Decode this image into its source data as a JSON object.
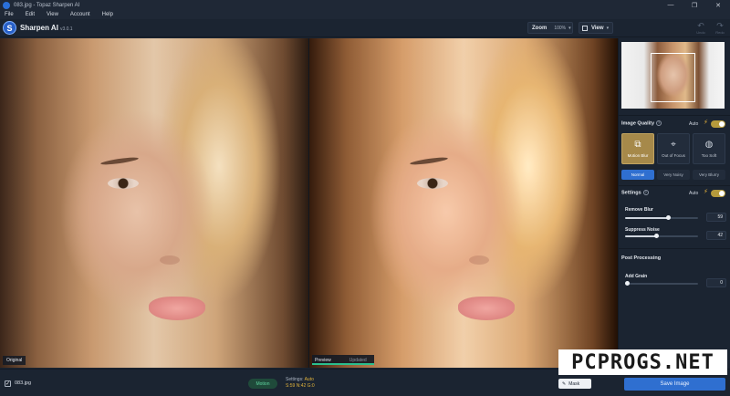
{
  "window": {
    "title": "083.jpg - Topaz Sharpen AI",
    "controls": [
      "—",
      "❐",
      "✕"
    ]
  },
  "menu": [
    "File",
    "Edit",
    "View",
    "Account",
    "Help"
  ],
  "header": {
    "app_name": "Sharpen AI",
    "version": "v3.0.1",
    "logo_letter": "S",
    "zoom_label": "Zoom",
    "zoom_value": "100%",
    "view_label": "View",
    "undo_label": "Undo",
    "redo_label": "Redo"
  },
  "viewer": {
    "left_label": "Original",
    "preview_label": "Preview",
    "updated_label": "Updated"
  },
  "panel": {
    "image_quality": {
      "title": "Image Quality",
      "auto_label": "Auto",
      "modes": [
        {
          "label": "Motion Blur",
          "active": true
        },
        {
          "label": "Out of Focus",
          "active": false
        },
        {
          "label": "Too Soft",
          "active": false
        }
      ],
      "levels": [
        {
          "label": "Normal",
          "active": true
        },
        {
          "label": "Very Noisy",
          "active": false
        },
        {
          "label": "Very Blurry",
          "active": false
        }
      ]
    },
    "settings": {
      "title": "Settings",
      "auto_label": "Auto",
      "remove_blur": {
        "label": "Remove Blur",
        "value": "59",
        "level": 59
      },
      "suppress_noise": {
        "label": "Suppress Noise",
        "value": "42",
        "level": 42
      }
    },
    "post_processing": {
      "title": "Post Processing",
      "add_grain": {
        "label": "Add Grain",
        "value": "0",
        "level": 0
      }
    }
  },
  "bottom": {
    "filename": "083.jpg",
    "check_mark": "✓",
    "mode_pill": "Motion",
    "settings_label": "Settings:",
    "settings_value": "Auto",
    "s_label": "S:",
    "s_value": "59",
    "n_label": "N:",
    "n_value": "42",
    "g_label": "G:",
    "g_value": "0",
    "mask_label": "Mask",
    "save_label": "Save Image"
  },
  "watermark": "PCPROGS.NET",
  "colors": {
    "accent_blue": "#2f6fd0",
    "active_mode": "#a6894a",
    "toggle_on": "#b59a3c",
    "preview_green": "#2bbf8e",
    "background": "#1b2431"
  }
}
